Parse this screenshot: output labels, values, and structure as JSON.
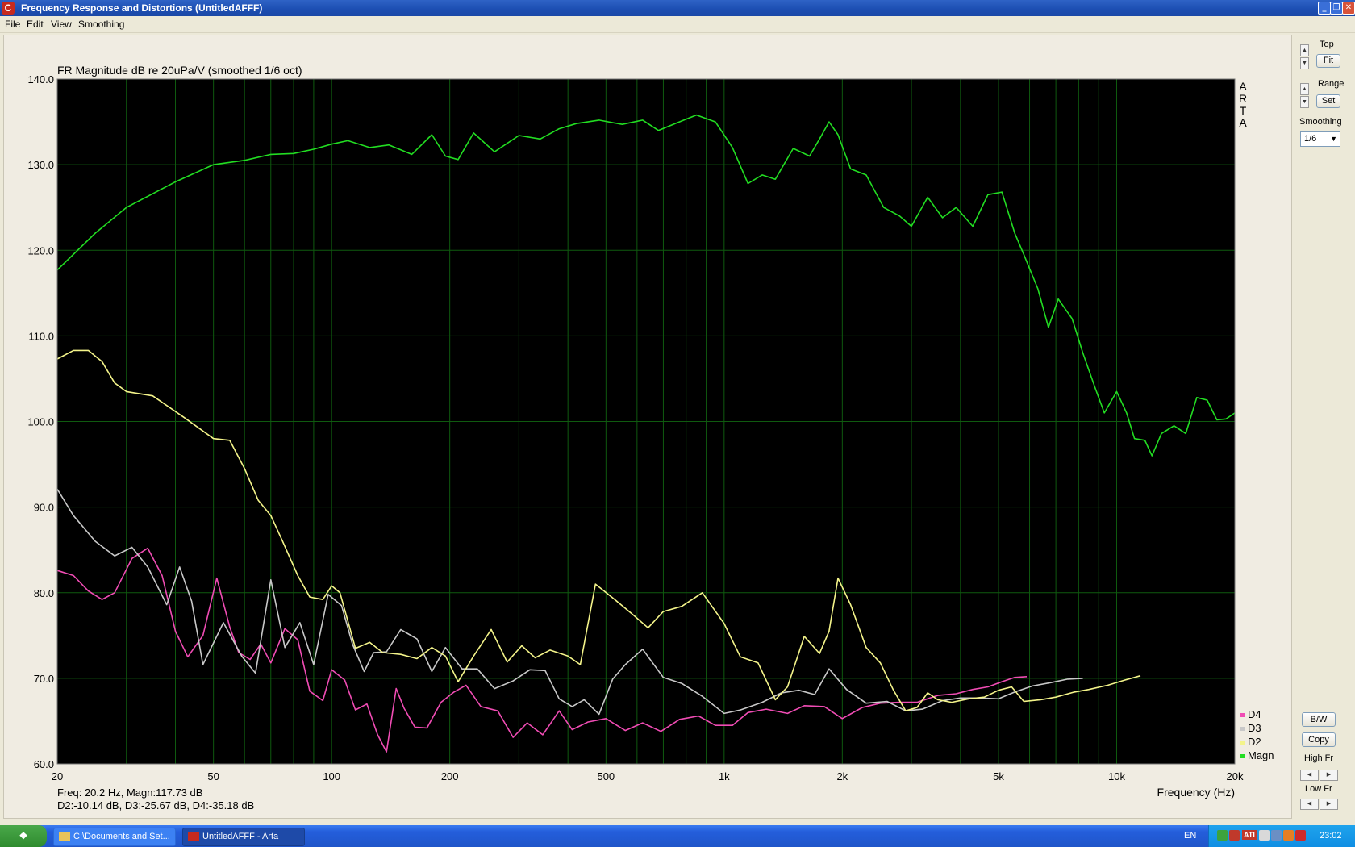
{
  "window": {
    "title": "Frequency Response and Distortions (UntitledAFFF)",
    "app_icon": "C"
  },
  "menu": [
    "File",
    "Edit",
    "View",
    "Smoothing"
  ],
  "colors": {
    "plot_bg": "#000000",
    "grid": "#0f5a0f",
    "magn": "#22dd22",
    "d2": "#f4f48a",
    "d3": "#c8c8c8",
    "d4": "#f04cb4"
  },
  "chart_data": {
    "type": "line",
    "title": "FR Magnitude dB re 20uPa/V (smoothed 1/6 oct)",
    "xlabel": "Frequency (Hz)",
    "ylabel": "",
    "x_scale": "log",
    "xlim": [
      20,
      20000
    ],
    "ylim": [
      60,
      140
    ],
    "xticks": [
      {
        "v": 20,
        "l": "20"
      },
      {
        "v": 50,
        "l": "50"
      },
      {
        "v": 100,
        "l": "100"
      },
      {
        "v": 200,
        "l": "200"
      },
      {
        "v": 500,
        "l": "500"
      },
      {
        "v": 1000,
        "l": "1k"
      },
      {
        "v": 2000,
        "l": "2k"
      },
      {
        "v": 5000,
        "l": "5k"
      },
      {
        "v": 10000,
        "l": "10k"
      },
      {
        "v": 20000,
        "l": "20k"
      }
    ],
    "yticks": [
      "140.0",
      "130.0",
      "120.0",
      "110.0",
      "100.0",
      "90.0",
      "80.0",
      "70.0",
      "60.0"
    ],
    "side_label": [
      "A",
      "R",
      "T",
      "A"
    ],
    "legend": [
      "D4",
      "D3",
      "D2",
      "Magn"
    ],
    "series": [
      {
        "name": "Magn",
        "color": "#22dd22",
        "points": [
          [
            20,
            117.7
          ],
          [
            25,
            122
          ],
          [
            30,
            125
          ],
          [
            40,
            128
          ],
          [
            50,
            130
          ],
          [
            60,
            130.5
          ],
          [
            70,
            131.2
          ],
          [
            80,
            131.3
          ],
          [
            90,
            131.8
          ],
          [
            100,
            132.4
          ],
          [
            110,
            132.8
          ],
          [
            125,
            132
          ],
          [
            140,
            132.3
          ],
          [
            160,
            131.2
          ],
          [
            180,
            133.5
          ],
          [
            195,
            131
          ],
          [
            210,
            130.6
          ],
          [
            230,
            133.7
          ],
          [
            260,
            131.5
          ],
          [
            300,
            133.4
          ],
          [
            340,
            133
          ],
          [
            380,
            134.2
          ],
          [
            420,
            134.8
          ],
          [
            480,
            135.2
          ],
          [
            550,
            134.7
          ],
          [
            620,
            135.2
          ],
          [
            680,
            134
          ],
          [
            760,
            134.9
          ],
          [
            850,
            135.8
          ],
          [
            950,
            135
          ],
          [
            1050,
            132
          ],
          [
            1150,
            127.8
          ],
          [
            1250,
            128.8
          ],
          [
            1350,
            128.3
          ],
          [
            1500,
            131.9
          ],
          [
            1650,
            131
          ],
          [
            1750,
            133
          ],
          [
            1850,
            135
          ],
          [
            1950,
            133.5
          ],
          [
            2100,
            129.5
          ],
          [
            2300,
            128.8
          ],
          [
            2550,
            125
          ],
          [
            2800,
            124
          ],
          [
            3000,
            122.8
          ],
          [
            3300,
            126.2
          ],
          [
            3600,
            123.8
          ],
          [
            3900,
            125
          ],
          [
            4300,
            122.8
          ],
          [
            4700,
            126.5
          ],
          [
            5100,
            126.8
          ],
          [
            5500,
            122
          ],
          [
            5800,
            119.5
          ],
          [
            6300,
            115.5
          ],
          [
            6700,
            111
          ],
          [
            7100,
            114.3
          ],
          [
            7700,
            112
          ],
          [
            8200,
            108
          ],
          [
            8800,
            104
          ],
          [
            9300,
            101
          ],
          [
            10000,
            103.5
          ],
          [
            10600,
            101
          ],
          [
            11100,
            98
          ],
          [
            11800,
            97.8
          ],
          [
            12300,
            96
          ],
          [
            13000,
            98.6
          ],
          [
            14000,
            99.5
          ],
          [
            15000,
            98.6
          ],
          [
            16000,
            102.8
          ],
          [
            17000,
            102.5
          ],
          [
            18000,
            100.2
          ],
          [
            19000,
            100.3
          ],
          [
            20000,
            101
          ]
        ]
      },
      {
        "name": "D2",
        "color": "#f4f48a",
        "points": [
          [
            20,
            107.3
          ],
          [
            22,
            108.3
          ],
          [
            24,
            108.3
          ],
          [
            26,
            107
          ],
          [
            28,
            104.5
          ],
          [
            30,
            103.5
          ],
          [
            35,
            103
          ],
          [
            42,
            100.5
          ],
          [
            50,
            98
          ],
          [
            55,
            97.8
          ],
          [
            60,
            94.5
          ],
          [
            65,
            90.8
          ],
          [
            70,
            89
          ],
          [
            75,
            86
          ],
          [
            82,
            82
          ],
          [
            88,
            79.5
          ],
          [
            95,
            79.2
          ],
          [
            100,
            80.8
          ],
          [
            105,
            80
          ],
          [
            115,
            73.5
          ],
          [
            125,
            74.2
          ],
          [
            135,
            73
          ],
          [
            150,
            72.8
          ],
          [
            165,
            72.3
          ],
          [
            180,
            73.6
          ],
          [
            195,
            72.6
          ],
          [
            210,
            69.6
          ],
          [
            230,
            72.6
          ],
          [
            255,
            75.7
          ],
          [
            280,
            71.9
          ],
          [
            305,
            73.8
          ],
          [
            330,
            72.4
          ],
          [
            360,
            73.3
          ],
          [
            400,
            72.6
          ],
          [
            430,
            71.6
          ],
          [
            470,
            81
          ],
          [
            520,
            79.4
          ],
          [
            580,
            77.6
          ],
          [
            640,
            75.9
          ],
          [
            700,
            77.8
          ],
          [
            780,
            78.4
          ],
          [
            880,
            80
          ],
          [
            1000,
            76.4
          ],
          [
            1100,
            72.5
          ],
          [
            1220,
            71.8
          ],
          [
            1350,
            67.5
          ],
          [
            1450,
            69
          ],
          [
            1600,
            74.9
          ],
          [
            1750,
            72.9
          ],
          [
            1850,
            75.5
          ],
          [
            1950,
            81.7
          ],
          [
            2100,
            78.6
          ],
          [
            2300,
            73.6
          ],
          [
            2500,
            71.8
          ],
          [
            2700,
            68.6
          ],
          [
            2900,
            66.2
          ],
          [
            3100,
            66.6
          ],
          [
            3300,
            68.3
          ],
          [
            3500,
            67.5
          ],
          [
            3800,
            67.2
          ],
          [
            4200,
            67.6
          ],
          [
            4600,
            67.8
          ],
          [
            5000,
            68.6
          ],
          [
            5400,
            69
          ],
          [
            5800,
            67.3
          ],
          [
            6400,
            67.5
          ],
          [
            7000,
            67.8
          ],
          [
            7800,
            68.4
          ],
          [
            8500,
            68.7
          ],
          [
            9500,
            69.2
          ],
          [
            10500,
            69.8
          ],
          [
            11500,
            70.3
          ]
        ]
      },
      {
        "name": "D3",
        "color": "#c8c8c8",
        "points": [
          [
            20,
            92.1
          ],
          [
            22,
            89
          ],
          [
            25,
            86
          ],
          [
            28,
            84.3
          ],
          [
            31,
            85.3
          ],
          [
            34,
            83
          ],
          [
            38,
            78.6
          ],
          [
            41,
            83
          ],
          [
            44,
            79
          ],
          [
            47,
            71.6
          ],
          [
            53,
            76.5
          ],
          [
            59,
            72.6
          ],
          [
            64,
            70.6
          ],
          [
            70,
            81.5
          ],
          [
            76,
            73.6
          ],
          [
            83,
            76.5
          ],
          [
            90,
            71.6
          ],
          [
            98,
            79.8
          ],
          [
            106,
            78.5
          ],
          [
            113,
            74
          ],
          [
            121,
            70.8
          ],
          [
            128,
            73
          ],
          [
            138,
            73.1
          ],
          [
            150,
            75.7
          ],
          [
            165,
            74.6
          ],
          [
            180,
            70.8
          ],
          [
            195,
            73.6
          ],
          [
            215,
            71.1
          ],
          [
            235,
            71.1
          ],
          [
            260,
            68.8
          ],
          [
            290,
            69.7
          ],
          [
            320,
            71
          ],
          [
            350,
            70.9
          ],
          [
            380,
            67.6
          ],
          [
            410,
            66.7
          ],
          [
            440,
            67.5
          ],
          [
            480,
            65.8
          ],
          [
            520,
            69.9
          ],
          [
            560,
            71.6
          ],
          [
            620,
            73.4
          ],
          [
            700,
            70.1
          ],
          [
            780,
            69.4
          ],
          [
            880,
            67.9
          ],
          [
            1000,
            65.9
          ],
          [
            1100,
            66.3
          ],
          [
            1250,
            67.2
          ],
          [
            1400,
            68.3
          ],
          [
            1550,
            68.6
          ],
          [
            1700,
            68.1
          ],
          [
            1850,
            71.1
          ],
          [
            2050,
            68.7
          ],
          [
            2300,
            67.1
          ],
          [
            2600,
            67.3
          ],
          [
            2900,
            66.2
          ],
          [
            3200,
            66.4
          ],
          [
            3600,
            67.4
          ],
          [
            4000,
            67.7
          ],
          [
            4500,
            67.7
          ],
          [
            5000,
            67.6
          ],
          [
            5500,
            68.4
          ],
          [
            6100,
            69.1
          ],
          [
            6800,
            69.5
          ],
          [
            7500,
            69.9
          ],
          [
            8200,
            70
          ]
        ]
      },
      {
        "name": "D4",
        "color": "#f04cb4",
        "points": [
          [
            20,
            82.6
          ],
          [
            22,
            82
          ],
          [
            24,
            80.2
          ],
          [
            26,
            79.2
          ],
          [
            28,
            80
          ],
          [
            31,
            84
          ],
          [
            34,
            85.2
          ],
          [
            37,
            82
          ],
          [
            40,
            75.5
          ],
          [
            43,
            72.5
          ],
          [
            47,
            75
          ],
          [
            51,
            81.7
          ],
          [
            55,
            76
          ],
          [
            58,
            73
          ],
          [
            62,
            72.2
          ],
          [
            66,
            74
          ],
          [
            70,
            71.8
          ],
          [
            76,
            75.8
          ],
          [
            82,
            74.5
          ],
          [
            88,
            68.5
          ],
          [
            95,
            67.4
          ],
          [
            100,
            71
          ],
          [
            108,
            69.8
          ],
          [
            115,
            66.3
          ],
          [
            123,
            67
          ],
          [
            131,
            63.4
          ],
          [
            138,
            61.4
          ],
          [
            146,
            68.8
          ],
          [
            153,
            66.5
          ],
          [
            163,
            64.3
          ],
          [
            175,
            64.2
          ],
          [
            190,
            67.2
          ],
          [
            205,
            68.4
          ],
          [
            220,
            69.2
          ],
          [
            240,
            66.7
          ],
          [
            265,
            66.2
          ],
          [
            290,
            63.1
          ],
          [
            315,
            64.8
          ],
          [
            345,
            63.4
          ],
          [
            380,
            66.2
          ],
          [
            410,
            64
          ],
          [
            450,
            64.9
          ],
          [
            500,
            65.3
          ],
          [
            560,
            63.9
          ],
          [
            620,
            64.8
          ],
          [
            690,
            63.8
          ],
          [
            770,
            65.2
          ],
          [
            860,
            65.6
          ],
          [
            950,
            64.5
          ],
          [
            1050,
            64.5
          ],
          [
            1150,
            66
          ],
          [
            1280,
            66.4
          ],
          [
            1450,
            65.9
          ],
          [
            1600,
            66.8
          ],
          [
            1800,
            66.7
          ],
          [
            2000,
            65.3
          ],
          [
            2250,
            66.6
          ],
          [
            2500,
            67.1
          ],
          [
            2800,
            67.2
          ],
          [
            3100,
            67.2
          ],
          [
            3500,
            68
          ],
          [
            3900,
            68.2
          ],
          [
            4300,
            68.7
          ],
          [
            4700,
            69
          ],
          [
            5100,
            69.6
          ],
          [
            5500,
            70.1
          ],
          [
            5900,
            70.2
          ]
        ]
      }
    ]
  },
  "readout": {
    "line1": "Freq: 20.2 Hz, Magn:117.73 dB",
    "line2": "D2:-10.14 dB, D3:-25.67 dB, D4:-35.18 dB"
  },
  "panel": {
    "top_label": "Top",
    "fit_button": "Fit",
    "range_label": "Range",
    "set_button": "Set",
    "smoothing_label": "Smoothing",
    "smoothing_value": "1/6",
    "bw_button": "B/W",
    "copy_button": "Copy",
    "high_fr_label": "High Fr",
    "low_fr_label": "Low Fr"
  },
  "taskbar": {
    "start": "",
    "tasks": [
      "C:\\Documents and Set...",
      "UntitledAFFF - Arta"
    ],
    "lang": "EN",
    "tray_text": "ATI",
    "clock": "23:02"
  }
}
